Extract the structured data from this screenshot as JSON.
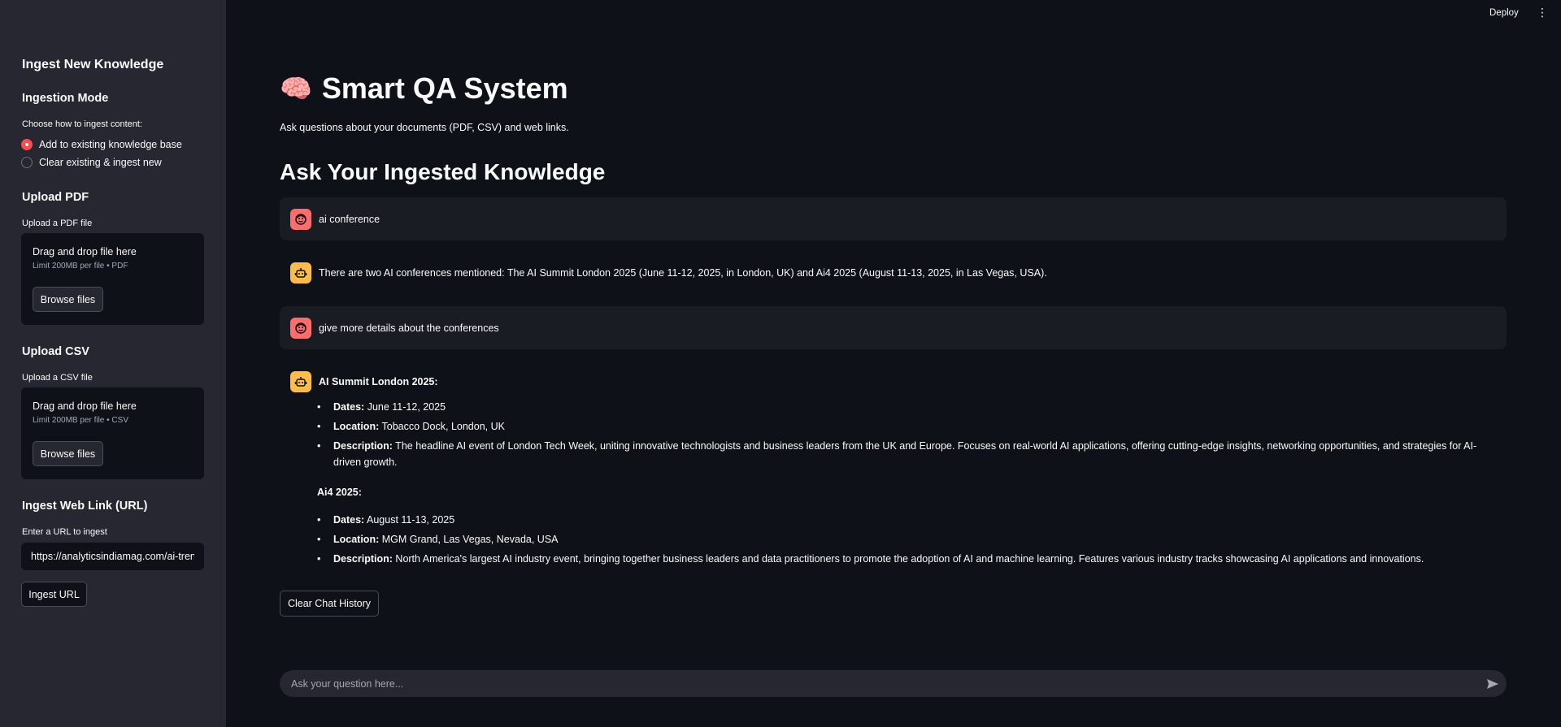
{
  "sidebar": {
    "header": "Ingest New Knowledge",
    "mode_title": "Ingestion Mode",
    "mode_label": "Choose how to ingest content:",
    "mode_options": [
      "Add to existing knowledge base",
      "Clear existing & ingest new"
    ],
    "mode_selected": "Add to existing knowledge base",
    "pdf": {
      "title": "Upload PDF",
      "label": "Upload a PDF file",
      "drop_text": "Drag and drop file here",
      "limit": "Limit 200MB per file • PDF",
      "button": "Browse files"
    },
    "csv": {
      "title": "Upload CSV",
      "label": "Upload a CSV file",
      "drop_text": "Drag and drop file here",
      "limit": "Limit 200MB per file • CSV",
      "button": "Browse files"
    },
    "url": {
      "title": "Ingest Web Link (URL)",
      "label": "Enter a URL to ingest",
      "value": "https://analyticsindiamag.com/ai-tren",
      "button": "Ingest URL"
    }
  },
  "topbar": {
    "deploy": "Deploy",
    "menu_icon": "⋮"
  },
  "main": {
    "title_icon": "🧠",
    "title": "Smart QA System",
    "subtitle": "Ask questions about your documents (PDF, CSV) and web links.",
    "section_title": "Ask Your Ingested Knowledge",
    "messages": {
      "m1": "ai conference",
      "m2": "There are two AI conferences mentioned: The AI Summit London 2025 (June 11-12, 2025, in London, UK) and Ai4 2025 (August 11-13, 2025, in Las Vegas, USA).",
      "m3": "give more details about the conferences",
      "m4": {
        "conf1": {
          "heading": "AI Summit London 2025:",
          "dates_label": "Dates:",
          "dates": " June 11-12, 2025",
          "location_label": "Location:",
          "location": " Tobacco Dock, London, UK",
          "desc_label": "Description:",
          "desc": " The headline AI event of London Tech Week, uniting innovative technologists and business leaders from the UK and Europe. Focuses on real-world AI applications, offering cutting-edge insights, networking opportunities, and strategies for AI-driven growth."
        },
        "conf2": {
          "heading": "Ai4 2025:",
          "dates_label": "Dates:",
          "dates": " August 11-13, 2025",
          "location_label": "Location:",
          "location": " MGM Grand, Las Vegas, Nevada, USA",
          "desc_label": "Description:",
          "desc": " North America's largest AI industry event, bringing together business leaders and data practitioners to promote the adoption of AI and machine learning. Features various industry tracks showcasing AI applications and innovations."
        }
      }
    },
    "clear_button": "Clear Chat History",
    "chat_placeholder": "Ask your question here..."
  },
  "colors": {
    "accent": "#ff4b4b",
    "user_avatar": "#ff6c6c",
    "bot_avatar": "#ffbd45",
    "sidebar_bg": "#262730",
    "main_bg": "#0e1117"
  }
}
